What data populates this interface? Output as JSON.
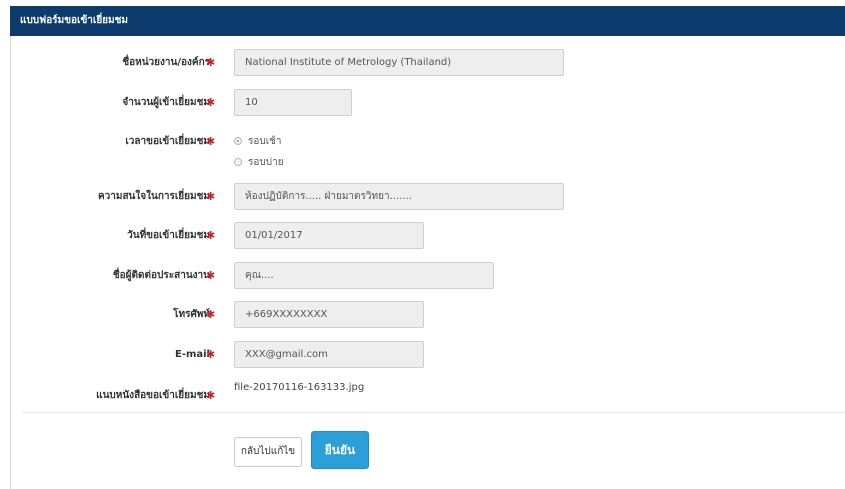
{
  "form": {
    "title": "แบบฟอร์มขอเข้าเยี่ยมชม",
    "required_marker": "✱",
    "fields": {
      "organization": {
        "label": "ชื่อหน่วยงาน/องค์กร",
        "value": "National Institute of Metrology (Thailand)"
      },
      "visitors": {
        "label": "จำนวนผู้เข้าเยี่ยมชม",
        "value": "10"
      },
      "visit_time": {
        "label": "เวลาขอเข้าเยี่ยมชม",
        "options": [
          {
            "label": "รอบเช้า",
            "selected": true
          },
          {
            "label": "รอบบ่าย",
            "selected": false
          }
        ]
      },
      "interest": {
        "label": "ความสนใจในการเยี่ยมชม",
        "value": "ห้องปฏิบัติการ..... ฝ่ายมาตรวิทยา......."
      },
      "visit_date": {
        "label": "วันที่ขอเข้าเยี่ยมชม",
        "value": "01/01/2017"
      },
      "contact_name": {
        "label": "ชื่อผู้ติดต่อประสานงาน",
        "value": "คุณ...."
      },
      "phone": {
        "label": "โทรศัพท์",
        "value": "+669XXXXXXXX"
      },
      "email": {
        "label": "E-mail",
        "value": "XXX@gmail.com"
      },
      "attachment": {
        "label": "แนบหนังสือขอเข้าเยี่ยมชม",
        "value": "file-20170116-163133.jpg"
      }
    },
    "buttons": {
      "back": "กลับไปแก้ไข",
      "confirm": "ยืนยัน"
    }
  }
}
